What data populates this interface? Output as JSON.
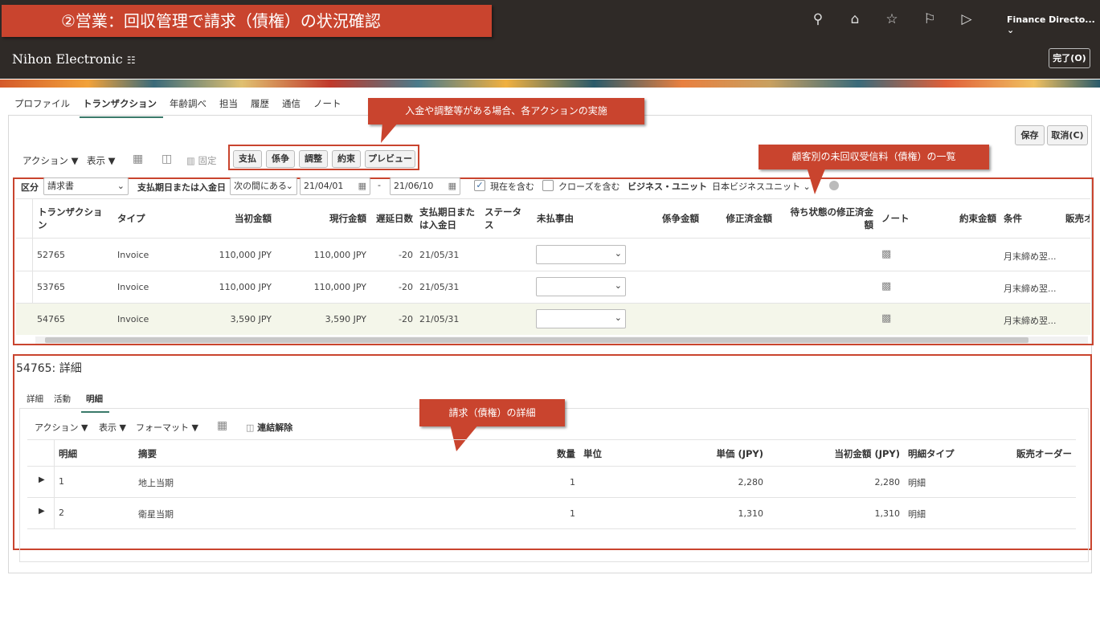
{
  "header": {
    "callout_title": "②営業：回収管理で請求（債権）の状況確認",
    "company": "Nihon Electronic",
    "user_menu": "Finance Directo...",
    "done_button": "完了(O)"
  },
  "tabs": [
    "プロファイル",
    "トランザクション",
    "年齢調べ",
    "担当",
    "履歴",
    "通信",
    "ノート"
  ],
  "callouts": {
    "actions": "入金や調整等がある場合、各アクションの実施",
    "list": "顧客別の未回収受信料（債権）の一覧",
    "detail": "請求（債権）の詳細"
  },
  "toolbar": {
    "actions": "アクション",
    "view": "表示",
    "freeze": "固定",
    "buttons": [
      "支払",
      "係争",
      "調整",
      "約束",
      "プレビュー"
    ],
    "save": "保存",
    "cancel": "取消(C)"
  },
  "filters": {
    "category_label": "区分",
    "category_value": "請求書",
    "date_label": "支払期日または入金日",
    "range_op": "次の間にある",
    "from": "21/04/01",
    "dash": "-",
    "to": "21/06/10",
    "include_current": "現在を含む",
    "include_closed": "クローズを含む",
    "bu_label": "ビジネス・ユニット",
    "bu_value": "日本ビジネスユニット"
  },
  "transactions": {
    "columns": [
      "トランザクション",
      "タイプ",
      "当初金額",
      "現行金額",
      "遅延日数",
      "支払期日または入金日",
      "ステータス",
      "未払事由",
      "係争金額",
      "修正済金額",
      "待ち状態の修正済金額",
      "ノート",
      "約束金額",
      "条件",
      "販売オ"
    ],
    "rows": [
      {
        "id": "52765",
        "type": "Invoice",
        "orig": "110,000 JPY",
        "curr": "110,000 JPY",
        "late": "-20",
        "date": "21/05/31",
        "terms": "月末締め翌..."
      },
      {
        "id": "53765",
        "type": "Invoice",
        "orig": "110,000 JPY",
        "curr": "110,000 JPY",
        "late": "-20",
        "date": "21/05/31",
        "terms": "月末締め翌..."
      },
      {
        "id": "54765",
        "type": "Invoice",
        "orig": "3,590 JPY",
        "curr": "3,590 JPY",
        "late": "-20",
        "date": "21/05/31",
        "terms": "月末締め翌..."
      }
    ]
  },
  "detail": {
    "title": "54765: 詳細",
    "tabs": [
      "詳細",
      "活動",
      "明細"
    ],
    "actions": "アクション",
    "view": "表示",
    "format": "フォーマット",
    "detach": "連結解除",
    "columns": [
      "明細",
      "摘要",
      "数量",
      "単位",
      "単価 (JPY)",
      "当初金額 (JPY)",
      "明細タイプ",
      "販売オーダー"
    ],
    "rows": [
      {
        "line": "1",
        "desc": "地上当期",
        "qty": "1",
        "unit_price": "2,280",
        "amount": "2,280",
        "type": "明細"
      },
      {
        "line": "2",
        "desc": "衛星当期",
        "qty": "1",
        "unit_price": "1,310",
        "amount": "1,310",
        "type": "明細"
      }
    ]
  },
  "colors": {
    "callout": "#c9442e",
    "topbar": "#2f2a27",
    "accent": "#3a7a6a"
  }
}
